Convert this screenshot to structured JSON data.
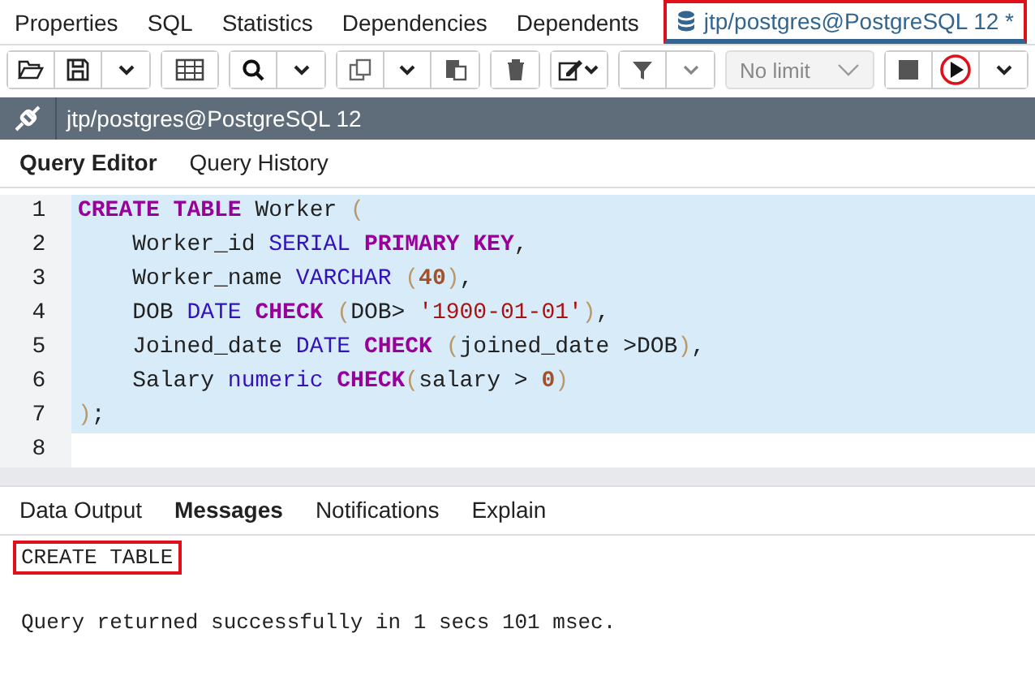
{
  "top_tabs": [
    {
      "label": "Properties",
      "selected": false
    },
    {
      "label": "SQL",
      "selected": false
    },
    {
      "label": "Statistics",
      "selected": false
    },
    {
      "label": "Dependencies",
      "selected": false
    },
    {
      "label": "Dependents",
      "selected": false
    },
    {
      "label": "jtp/postgres@PostgreSQL 12 *",
      "selected": true
    }
  ],
  "toolbar": {
    "limit_select": "No limit"
  },
  "connection": "jtp/postgres@PostgreSQL 12",
  "editor_tabs": [
    {
      "label": "Query Editor",
      "selected": true
    },
    {
      "label": "Query History",
      "selected": false
    }
  ],
  "code_lines": [
    {
      "number": "1",
      "selected": true,
      "tokens": [
        {
          "kind": "kw",
          "text": "CREATE TABLE"
        },
        {
          "kind": "plain",
          "text": " Worker "
        },
        {
          "kind": "paren",
          "text": "("
        }
      ]
    },
    {
      "number": "2",
      "selected": true,
      "tokens": [
        {
          "kind": "plain",
          "text": "    Worker_id "
        },
        {
          "kind": "type",
          "text": "SERIAL "
        },
        {
          "kind": "kw",
          "text": "PRIMARY KEY"
        },
        {
          "kind": "plain",
          "text": ","
        }
      ]
    },
    {
      "number": "3",
      "selected": true,
      "tokens": [
        {
          "kind": "plain",
          "text": "    Worker_name "
        },
        {
          "kind": "type",
          "text": "VARCHAR "
        },
        {
          "kind": "paren",
          "text": "("
        },
        {
          "kind": "num",
          "text": "40"
        },
        {
          "kind": "paren",
          "text": ")"
        },
        {
          "kind": "plain",
          "text": ","
        }
      ]
    },
    {
      "number": "4",
      "selected": true,
      "tokens": [
        {
          "kind": "plain",
          "text": "    DOB "
        },
        {
          "kind": "type",
          "text": "DATE "
        },
        {
          "kind": "kw",
          "text": "CHECK "
        },
        {
          "kind": "paren",
          "text": "("
        },
        {
          "kind": "plain",
          "text": "DOB> "
        },
        {
          "kind": "str",
          "text": "'1900-01-01'"
        },
        {
          "kind": "paren",
          "text": ")"
        },
        {
          "kind": "plain",
          "text": ","
        }
      ]
    },
    {
      "number": "5",
      "selected": true,
      "tokens": [
        {
          "kind": "plain",
          "text": "    Joined_date "
        },
        {
          "kind": "type",
          "text": "DATE "
        },
        {
          "kind": "kw",
          "text": "CHECK "
        },
        {
          "kind": "paren",
          "text": "("
        },
        {
          "kind": "plain",
          "text": "joined_date >DOB"
        },
        {
          "kind": "paren",
          "text": ")"
        },
        {
          "kind": "plain",
          "text": ","
        }
      ]
    },
    {
      "number": "6",
      "selected": true,
      "tokens": [
        {
          "kind": "plain",
          "text": "    Salary "
        },
        {
          "kind": "type",
          "text": "numeric "
        },
        {
          "kind": "kw",
          "text": "CHECK"
        },
        {
          "kind": "paren",
          "text": "("
        },
        {
          "kind": "plain",
          "text": "salary > "
        },
        {
          "kind": "num",
          "text": "0"
        },
        {
          "kind": "paren",
          "text": ")"
        }
      ]
    },
    {
      "number": "7",
      "selected": true,
      "tokens": [
        {
          "kind": "paren",
          "text": ")"
        },
        {
          "kind": "plain",
          "text": ";"
        }
      ]
    },
    {
      "number": "8",
      "selected": false
    }
  ],
  "output_tabs": [
    {
      "label": "Data Output",
      "selected": false
    },
    {
      "label": "Messages",
      "selected": true
    },
    {
      "label": "Notifications",
      "selected": false
    },
    {
      "label": "Explain",
      "selected": false
    }
  ],
  "messages": [
    {
      "text": "CREATE TABLE",
      "highlighted": true
    },
    {
      "text": "Query returned successfully in 1 secs 101 msec.",
      "highlighted": false
    }
  ]
}
